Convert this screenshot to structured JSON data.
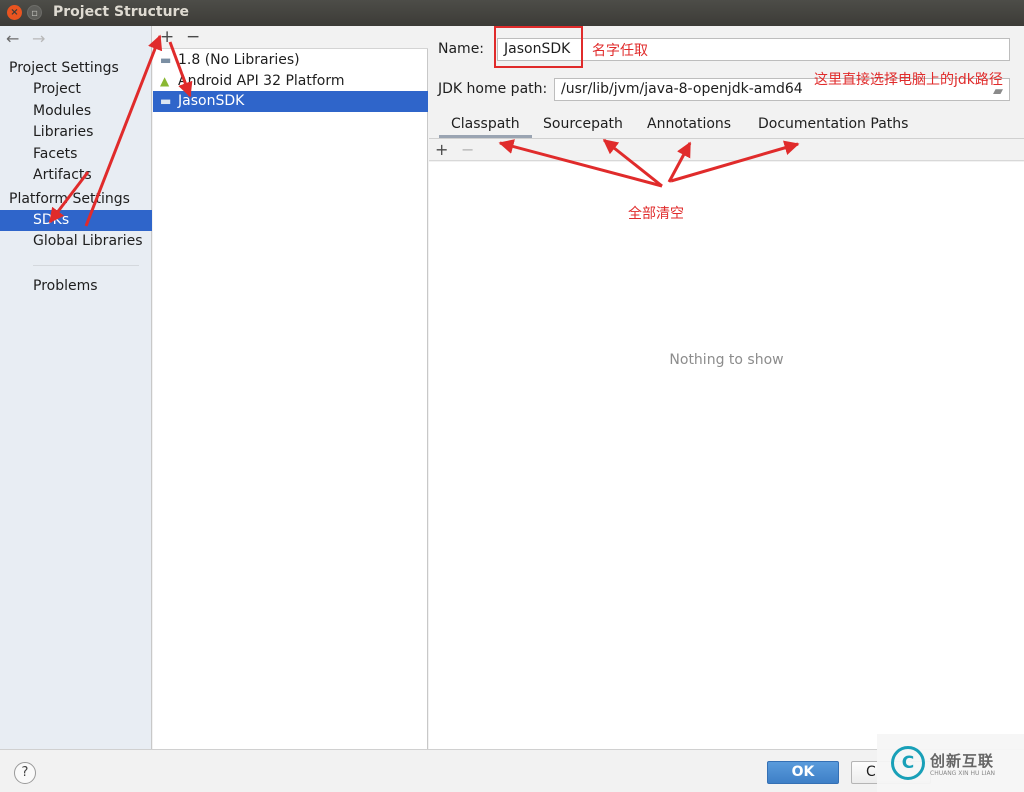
{
  "window": {
    "title": "Project Structure"
  },
  "sidebar": {
    "back_arrow": "←",
    "forward_arrow": "→",
    "project_settings_header": "Project Settings",
    "project_items": [
      "Project",
      "Modules",
      "Libraries",
      "Facets",
      "Artifacts"
    ],
    "platform_settings_header": "Platform Settings",
    "platform_items": [
      "SDKs",
      "Global Libraries"
    ],
    "selected": "SDKs",
    "problems": "Problems"
  },
  "sdk_list": {
    "add_label": "+",
    "remove_label": "−",
    "items": [
      {
        "label": "1.8 (No Libraries)",
        "icon": "folder-icon"
      },
      {
        "label": "Android API 32 Platform",
        "icon": "android-icon"
      },
      {
        "label": "JasonSDK",
        "icon": "folder-icon"
      }
    ],
    "selected": "JasonSDK"
  },
  "detail": {
    "name_label": "Name:",
    "name_value": "JasonSDK",
    "jdk_home_label": "JDK home path:",
    "jdk_home_value": "/usr/lib/jvm/java-8-openjdk-amd64",
    "tabs": [
      "Classpath",
      "Sourcepath",
      "Annotations",
      "Documentation Paths"
    ],
    "active_tab": "Classpath",
    "add_label": "+",
    "remove_label": "−",
    "empty_text": "Nothing to show"
  },
  "footer": {
    "help_label": "?",
    "ok_label": "OK",
    "cancel_label": "C"
  },
  "annotations": {
    "name_note": "名字任取",
    "path_note": "这里直接选择电脑上的jdk路径",
    "clear_note": "全部清空",
    "color": "#e02b2b"
  },
  "watermark": {
    "brand_cn": "创新互联",
    "brand_en": "CHUANG XIN HU LIAN"
  },
  "colors": {
    "selection": "#2f65ca",
    "ok_button": "#4a8ad2",
    "titlebar": "#3c3b37"
  }
}
